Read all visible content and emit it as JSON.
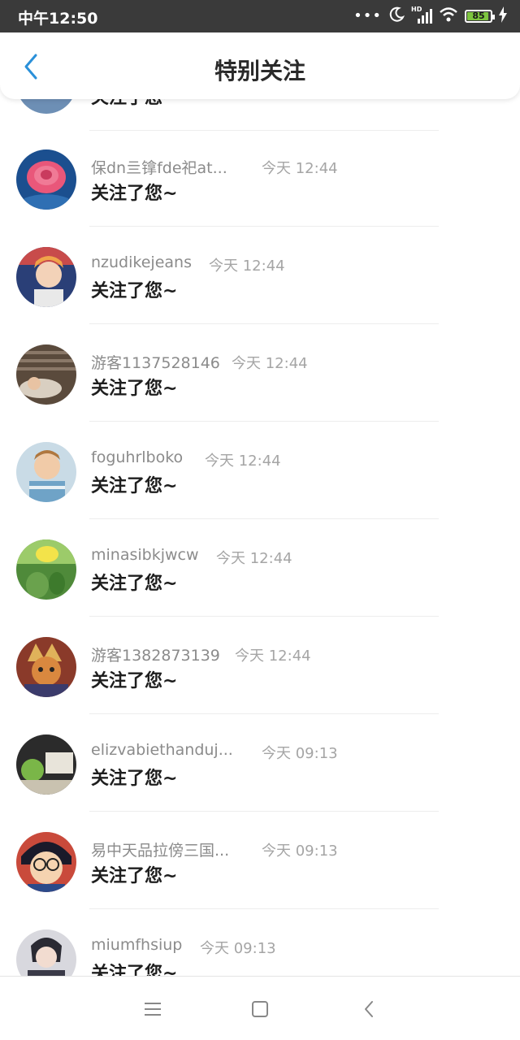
{
  "status_bar": {
    "time": "中午12:50",
    "battery": "85",
    "dots": "•••",
    "network_label": "HD"
  },
  "header": {
    "title": "特别关注"
  },
  "colors": {
    "accent": "#2a90d9",
    "battery_green": "#7dc53f"
  },
  "list": {
    "partial_message": "关注了您~",
    "items": [
      {
        "name": "保dn亖镎fde祀at...",
        "time": "今天 12:44",
        "message": "关注了您~"
      },
      {
        "name": "nzudikejeans",
        "time": "今天 12:44",
        "message": "关注了您~"
      },
      {
        "name": "游客1137528146",
        "time": "今天 12:44",
        "message": "关注了您~"
      },
      {
        "name": "foguhrlboko",
        "time": "今天 12:44",
        "message": "关注了您~"
      },
      {
        "name": "minasibkjwcw",
        "time": "今天 12:44",
        "message": "关注了您~"
      },
      {
        "name": "游客1382873139",
        "time": "今天 12:44",
        "message": "关注了您~"
      },
      {
        "name": "elizvabiethanduj...",
        "time": "今天 09:13",
        "message": "关注了您~"
      },
      {
        "name": "易中天品拉傍三国...",
        "time": "今天 09:13",
        "message": "关注了您~"
      },
      {
        "name": "miumfhsiup",
        "time": "今天 09:13",
        "message": "关注了您~"
      }
    ]
  }
}
